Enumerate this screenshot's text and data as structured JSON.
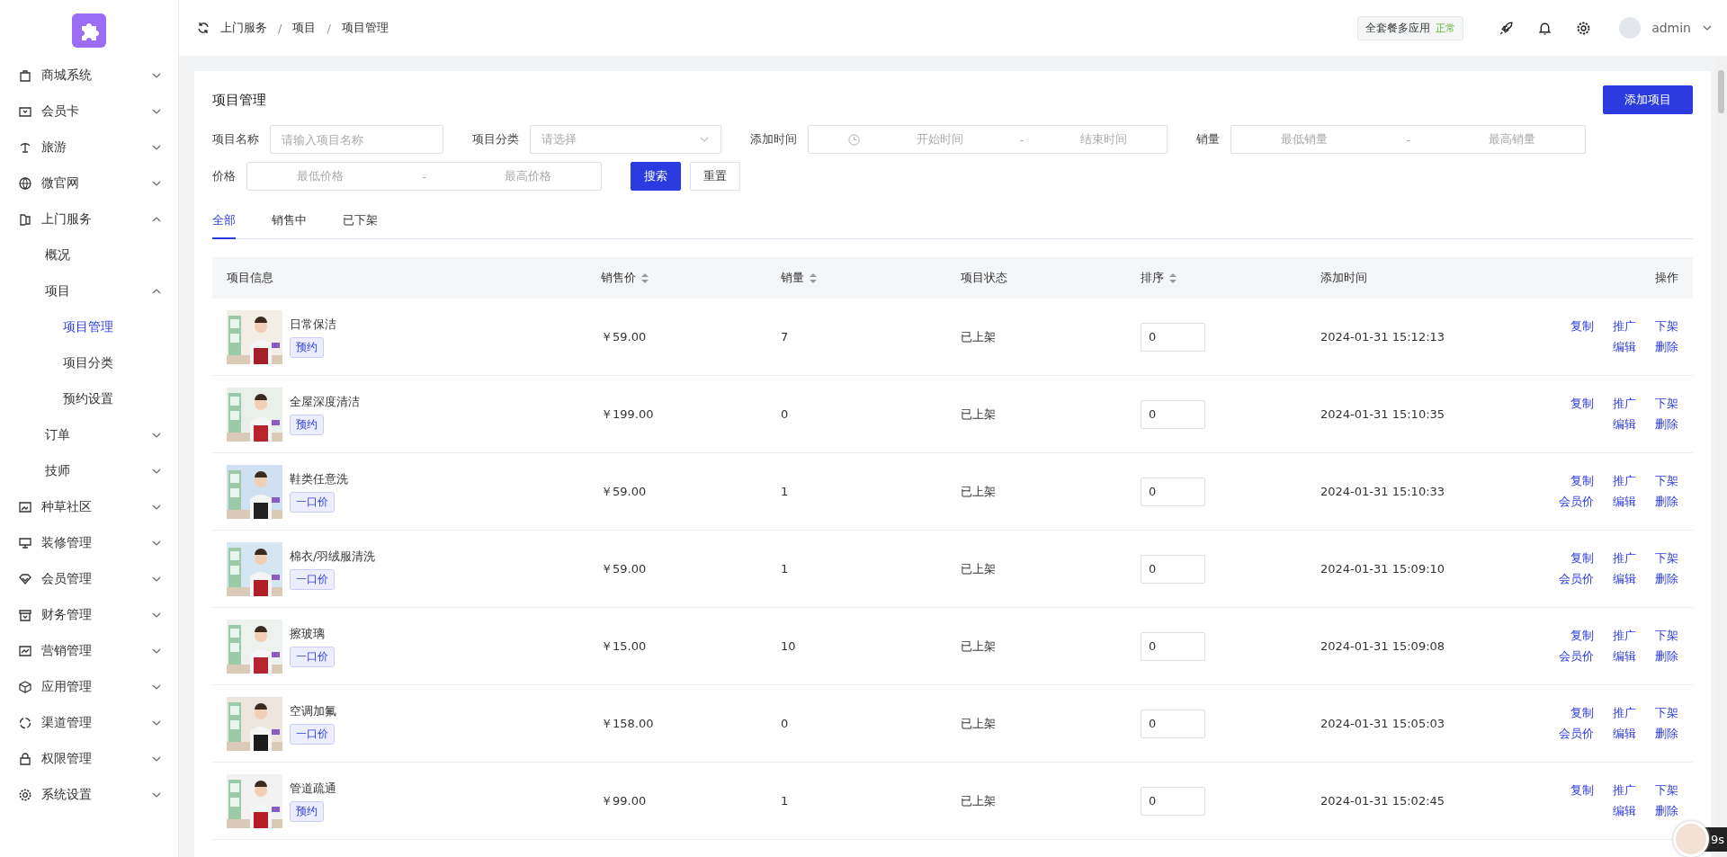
{
  "sidebar": {
    "items": [
      {
        "label": "商城系统",
        "expanded": false,
        "selected": false
      },
      {
        "label": "会员卡",
        "expanded": false,
        "selected": false
      },
      {
        "label": "旅游",
        "expanded": false,
        "selected": false
      },
      {
        "label": "微官网",
        "expanded": false,
        "selected": false
      },
      {
        "label": "上门服务",
        "expanded": true,
        "selected": false,
        "children": [
          {
            "label": "概况",
            "selected": false
          },
          {
            "label": "项目",
            "expanded": true,
            "selected": false,
            "children": [
              {
                "label": "项目管理",
                "selected": true
              },
              {
                "label": "项目分类",
                "selected": false
              },
              {
                "label": "预约设置",
                "selected": false
              }
            ]
          },
          {
            "label": "订单",
            "expanded": false,
            "selected": false
          },
          {
            "label": "技师",
            "expanded": false,
            "selected": false
          }
        ]
      },
      {
        "label": "种草社区",
        "expanded": false,
        "selected": false
      },
      {
        "label": "装修管理",
        "expanded": false,
        "selected": false
      },
      {
        "label": "会员管理",
        "expanded": false,
        "selected": false
      },
      {
        "label": "财务管理",
        "expanded": false,
        "selected": false
      },
      {
        "label": "营销管理",
        "expanded": false,
        "selected": false
      },
      {
        "label": "应用管理",
        "expanded": false,
        "selected": false
      },
      {
        "label": "渠道管理",
        "expanded": false,
        "selected": false
      },
      {
        "label": "权限管理",
        "expanded": false,
        "selected": false
      },
      {
        "label": "系统设置",
        "expanded": false,
        "selected": false
      }
    ]
  },
  "header": {
    "breadcrumbs": [
      "上门服务",
      "项目",
      "项目管理"
    ],
    "breadcrumb_separator": "/",
    "plan": {
      "label": "全套餐多应用",
      "status": "正常"
    },
    "user": "admin"
  },
  "page": {
    "title": "项目管理",
    "add_button": "添加项目",
    "filters": [
      {
        "kind": "text",
        "label": "项目名称",
        "placeholder": "请输入项目名称"
      },
      {
        "kind": "select",
        "label": "项目分类",
        "placeholder": "请选择"
      },
      {
        "kind": "daterange",
        "label": "添加时间",
        "from_placeholder": "开始时间",
        "separator": "-",
        "to_placeholder": "结束时间"
      },
      {
        "kind": "range",
        "label": "销量",
        "from_placeholder": "最低销量",
        "separator": "-",
        "to_placeholder": "最高销量"
      },
      {
        "kind": "range",
        "label": "价格",
        "from_placeholder": "最低价格",
        "separator": "-",
        "to_placeholder": "最高价格"
      }
    ],
    "search_button": "搜索",
    "reset_button": "重置",
    "tabs": [
      {
        "label": "全部",
        "selected": true
      },
      {
        "label": "销售中",
        "selected": false
      },
      {
        "label": "已下架",
        "selected": false
      }
    ],
    "table": {
      "columns": [
        {
          "label": "项目信息",
          "sortable": false
        },
        {
          "label": "销售价",
          "sortable": true
        },
        {
          "label": "销量",
          "sortable": true
        },
        {
          "label": "项目状态",
          "sortable": false
        },
        {
          "label": "排序",
          "sortable": true
        },
        {
          "label": "添加时间",
          "sortable": false
        },
        {
          "label": "操作",
          "sortable": false
        }
      ],
      "rows": [
        {
          "name": "日常保洁",
          "tag": "预约",
          "price": "￥59.00",
          "sales": "7",
          "status": "已上架",
          "sort": "0",
          "added": "2024-01-31 15:12:13",
          "actions_top": [
            "复制",
            "推广",
            "下架"
          ],
          "actions_bottom": [
            "编辑",
            "删除"
          ]
        },
        {
          "name": "全屋深度清洁",
          "tag": "预约",
          "price": "￥199.00",
          "sales": "0",
          "status": "已上架",
          "sort": "0",
          "added": "2024-01-31 15:10:35",
          "actions_top": [
            "复制",
            "推广",
            "下架"
          ],
          "actions_bottom": [
            "编辑",
            "删除"
          ]
        },
        {
          "name": "鞋类任意洗",
          "tag": "一口价",
          "price": "￥59.00",
          "sales": "1",
          "status": "已上架",
          "sort": "0",
          "added": "2024-01-31 15:10:33",
          "actions_top": [
            "复制",
            "推广",
            "下架"
          ],
          "actions_bottom": [
            "会员价",
            "编辑",
            "删除"
          ]
        },
        {
          "name": "棉衣/羽绒服清洗",
          "tag": "一口价",
          "price": "￥59.00",
          "sales": "1",
          "status": "已上架",
          "sort": "0",
          "added": "2024-01-31 15:09:10",
          "actions_top": [
            "复制",
            "推广",
            "下架"
          ],
          "actions_bottom": [
            "会员价",
            "编辑",
            "删除"
          ]
        },
        {
          "name": "擦玻璃",
          "tag": "一口价",
          "price": "￥15.00",
          "sales": "10",
          "status": "已上架",
          "sort": "0",
          "added": "2024-01-31 15:09:08",
          "actions_top": [
            "复制",
            "推广",
            "下架"
          ],
          "actions_bottom": [
            "会员价",
            "编辑",
            "删除"
          ]
        },
        {
          "name": "空调加氟",
          "tag": "一口价",
          "price": "￥158.00",
          "sales": "0",
          "status": "已上架",
          "sort": "0",
          "added": "2024-01-31 15:05:03",
          "actions_top": [
            "复制",
            "推广",
            "下架"
          ],
          "actions_bottom": [
            "会员价",
            "编辑",
            "删除"
          ]
        },
        {
          "name": "管道疏通",
          "tag": "预约",
          "price": "￥99.00",
          "sales": "1",
          "status": "已上架",
          "sort": "0",
          "added": "2024-01-31 15:02:45",
          "actions_top": [
            "复制",
            "推广",
            "下架"
          ],
          "actions_bottom": [
            "编辑",
            "删除"
          ]
        }
      ]
    }
  },
  "floating_widget": {
    "timer": "9s"
  }
}
